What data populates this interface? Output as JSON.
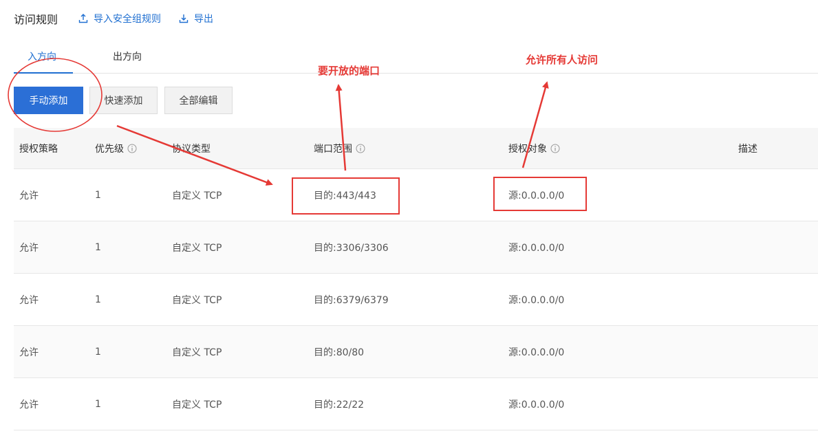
{
  "header": {
    "title": "访问规则",
    "import_label": "导入安全组规则",
    "export_label": "导出"
  },
  "tabs": [
    {
      "label": "入方向",
      "active": true
    },
    {
      "label": "出方向",
      "active": false
    }
  ],
  "toolbar": {
    "manual_add_label": "手动添加",
    "quick_add_label": "快速添加",
    "edit_all_label": "全部编辑"
  },
  "table": {
    "columns": [
      "授权策略",
      "优先级",
      "协议类型",
      "端口范围",
      "授权对象",
      "描述"
    ],
    "rows": [
      {
        "policy": "允许",
        "priority": "1",
        "protocol": "自定义 TCP",
        "port": "目的:443/443",
        "source": "源:0.0.0.0/0",
        "desc": ""
      },
      {
        "policy": "允许",
        "priority": "1",
        "protocol": "自定义 TCP",
        "port": "目的:3306/3306",
        "source": "源:0.0.0.0/0",
        "desc": ""
      },
      {
        "policy": "允许",
        "priority": "1",
        "protocol": "自定义 TCP",
        "port": "目的:6379/6379",
        "source": "源:0.0.0.0/0",
        "desc": ""
      },
      {
        "policy": "允许",
        "priority": "1",
        "protocol": "自定义 TCP",
        "port": "目的:80/80",
        "source": "源:0.0.0.0/0",
        "desc": ""
      },
      {
        "policy": "允许",
        "priority": "1",
        "protocol": "自定义 TCP",
        "port": "目的:22/22",
        "source": "源:0.0.0.0/0",
        "desc": ""
      }
    ]
  },
  "annotations": {
    "port_note": "要开放的端口",
    "access_note": "允许所有人访问",
    "color": "#e53935"
  },
  "colors": {
    "accent": "#1f6fd1",
    "primary_button": "#2b6fd6"
  }
}
